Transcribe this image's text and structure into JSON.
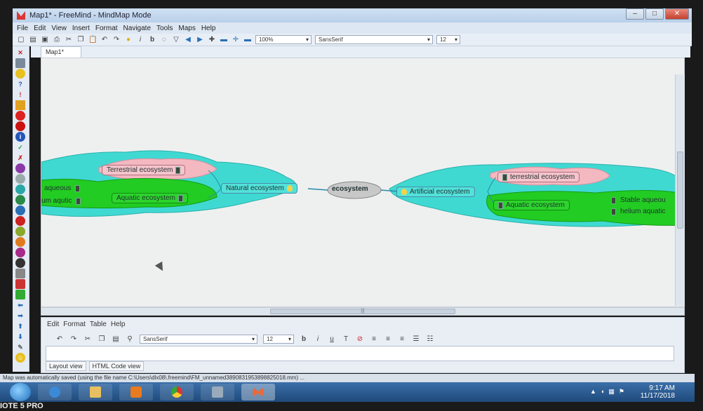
{
  "window": {
    "title": "Map1* - FreeMind - MindMap Mode",
    "controls": [
      "–",
      "□",
      "✕"
    ]
  },
  "menubar": [
    "File",
    "Edit",
    "View",
    "Insert",
    "Format",
    "Navigate",
    "Tools",
    "Maps",
    "Help"
  ],
  "toolbar": {
    "zoom": "100%",
    "font": "SansSerif",
    "font_size": "12"
  },
  "tabs": [
    {
      "label": "Map1*"
    }
  ],
  "mindmap": {
    "root": "ecosystem",
    "left": {
      "main": "Natural ecosystem",
      "children": [
        "Terrestrial ecosystem",
        "Aquatic ecosystem"
      ],
      "grandchildren": [
        "aqueous",
        "um aqutic"
      ]
    },
    "right": {
      "main": "Artificial ecosystem",
      "children": [
        "terrestrial ecosystem",
        "Aquatic ecosystem"
      ],
      "grandchildren": [
        "Stable aqueou",
        "helium aquatic"
      ]
    },
    "colors": {
      "cloud_cyan": "#3fd9d2",
      "cloud_green": "#22cc22",
      "cloud_pink": "#f4b8c0",
      "root_fill": "#c8c8c8"
    }
  },
  "editor": {
    "menu": [
      "Edit",
      "Format",
      "Table",
      "Help"
    ],
    "font": "SansSerif",
    "font_size": "12",
    "tabs": [
      "Layout view",
      "HTML Code view"
    ]
  },
  "status": {
    "text": "Map was automatically saved (using the file name C:\\Users\\dlx08\\.freemind\\FM_unnamed3890831953898825018.mm) ..."
  },
  "taskbar": {
    "time": "9:17 AM",
    "date": "11/17/2018"
  },
  "watermark": "IOTE 5 PRO"
}
